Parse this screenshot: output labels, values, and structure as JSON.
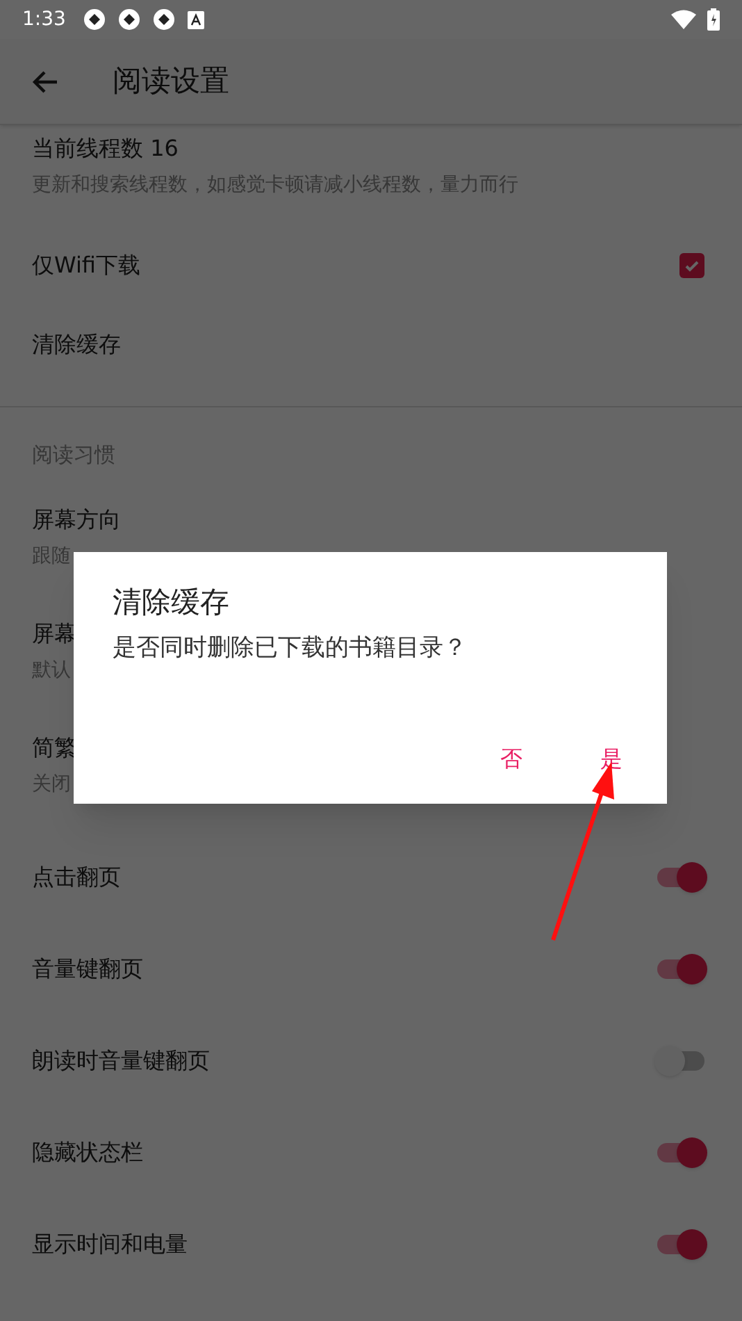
{
  "status_bar": {
    "time": "1:33"
  },
  "toolbar": {
    "title": "阅读设置"
  },
  "settings": [
    {
      "kind": "text",
      "title": "当前线程数 16",
      "subtitle": "更新和搜索线程数，如感觉卡顿请减小线程数，量力而行"
    },
    {
      "kind": "checkbox",
      "title": "仅Wifi下载",
      "checked": true
    },
    {
      "kind": "text",
      "title": "清除缓存"
    },
    {
      "kind": "header",
      "title": "阅读习惯"
    },
    {
      "kind": "text",
      "title": "屏幕方向",
      "subtitle": "跟随"
    },
    {
      "kind": "text",
      "title": "屏幕",
      "subtitle": "默认"
    },
    {
      "kind": "text",
      "title": "简繁",
      "subtitle": "关闭"
    },
    {
      "kind": "switch",
      "title": "点击翻页",
      "on": true
    },
    {
      "kind": "switch",
      "title": "音量键翻页",
      "on": true
    },
    {
      "kind": "switch",
      "title": "朗读时音量键翻页",
      "on": false
    },
    {
      "kind": "switch",
      "title": "隐藏状态栏",
      "on": true
    },
    {
      "kind": "switch",
      "title": "显示时间和电量",
      "on": true
    }
  ],
  "dialog": {
    "title": "清除缓存",
    "message": "是否同时删除已下载的书籍目录？",
    "buttons": [
      {
        "label": "否"
      },
      {
        "label": "是"
      }
    ]
  }
}
